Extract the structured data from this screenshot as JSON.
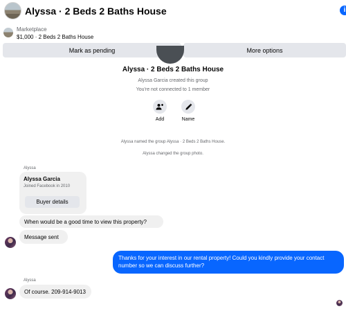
{
  "header": {
    "title": "Alyssa · 2 Beds 2 Baths House",
    "avatar_icon": "house-photo",
    "info_icon": "info-icon",
    "info_glyph": "i"
  },
  "marketplace": {
    "label": "Marketplace",
    "listing": "$1,000 · 2 Beds 2 Baths House",
    "thumbnail_icon": "house-photo",
    "mark_pending_label": "Mark as pending",
    "more_options_label": "More options"
  },
  "group": {
    "title": "Alyssa · 2 Beds 2 Baths House",
    "created_text": "Alyssa Garcia created this group",
    "connection_text": "You're not connected to 1 member",
    "actions": [
      {
        "label": "Add",
        "icon": "add-person-icon"
      },
      {
        "label": "Name",
        "icon": "pencil-icon"
      }
    ]
  },
  "events": [
    "Alyssa named the group Alyssa · 2 Beds 2 Baths House.",
    "Alyssa changed the group photo."
  ],
  "messages": {
    "sender1": "Alyssa",
    "profile_card": {
      "name": "Alyssa Garcia",
      "joined": "Joined Facebook in 2010",
      "button_label": "Buyer details"
    },
    "incoming_1": "When would be a good time to view this property?",
    "incoming_2": "Message sent",
    "outgoing_1": "Thanks for your interest in our rental property! Could you kindly provide your contact number so we can discuss further?",
    "sender2": "Alyssa",
    "incoming_3": "Of course. 209-914-9013"
  },
  "colors": {
    "accent_blue": "#0866ff",
    "bubble_gray": "#f0f0f0",
    "button_gray": "#e4e6eb",
    "secondary_text": "#65676b"
  }
}
